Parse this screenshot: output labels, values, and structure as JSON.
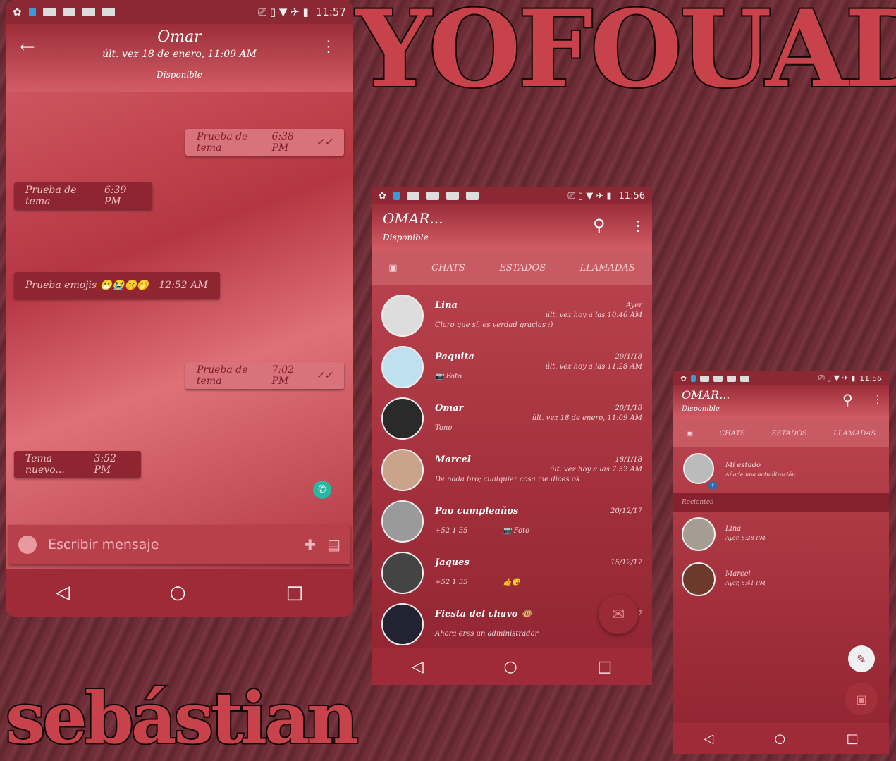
{
  "overlay": {
    "title": "YOFOUAD",
    "signature": "sebástian"
  },
  "chat_screen": {
    "time": "11:57",
    "contact": "Omar",
    "last_seen": "últ. vez 18 de enero, 11:09 AM",
    "status": "Disponible",
    "messages": [
      {
        "dir": "out",
        "text": "Prueba de tema",
        "time": "6:38 PM",
        "ticks": "✓✓"
      },
      {
        "dir": "in",
        "text": "Prueba de tema",
        "time": "6:39 PM"
      },
      {
        "dir": "in",
        "text": "Prueba emojis 😷😭🤫🤭",
        "time": "12:52 AM"
      },
      {
        "dir": "out",
        "text": "Prueba de tema",
        "time": "7:02 PM",
        "ticks": "✓✓"
      },
      {
        "dir": "in",
        "text": "Tema nuevo...",
        "time": "3:52 PM"
      }
    ],
    "input_placeholder": "Escribir mensaje"
  },
  "chats_screen": {
    "time": "11:56",
    "title": "OMAR...",
    "status": "Disponible",
    "tabs": [
      "CHATS",
      "ESTADOS",
      "LLAMADAS"
    ],
    "chats": [
      {
        "name": "Lina",
        "preview": "Claro que sí, es verdad gracias :)",
        "date": "Ayer",
        "seen": "últ. vez hoy a las 10:46 AM"
      },
      {
        "name": "Paquita",
        "preview": "📷 Foto",
        "date": "20/1/18",
        "seen": "últ. vez hoy a las 11:28 AM"
      },
      {
        "name": "Omar",
        "preview": "Tono",
        "date": "20/1/18",
        "seen": "últ. vez 18 de enero, 11:09 AM"
      },
      {
        "name": "Marcel",
        "preview": "De nada bro; cualquier cosa me dices ok",
        "date": "18/1/18",
        "seen": "últ. vez hoy a las 7:52 AM"
      },
      {
        "name": "Pao cumpleaños",
        "preview": "+52 1 55",
        "extra": "📷 Foto",
        "date": "20/12/17"
      },
      {
        "name": "Jaques",
        "preview": "+52 1 55",
        "extra": "👍😘",
        "date": "15/12/17"
      },
      {
        "name": "Fiesta del chavo 🐵",
        "preview": "Ahora eres un administrador",
        "date": "7"
      }
    ]
  },
  "status_screen": {
    "time": "11:56",
    "title": "OMAR...",
    "status": "Disponible",
    "tabs": [
      "CHATS",
      "ESTADOS",
      "LLAMADAS"
    ],
    "my_status": {
      "name": "Mi estado",
      "hint": "Añade una actualización"
    },
    "section": "Recientes",
    "updates": [
      {
        "name": "Lina",
        "time": "Ayer, 6:28 PM"
      },
      {
        "name": "Marcel",
        "time": "Ayer, 5:41 PM"
      }
    ]
  },
  "colors": {
    "accent": "#c04a55",
    "dark": "#8c2833",
    "fab_green": "#2ab6a0"
  }
}
